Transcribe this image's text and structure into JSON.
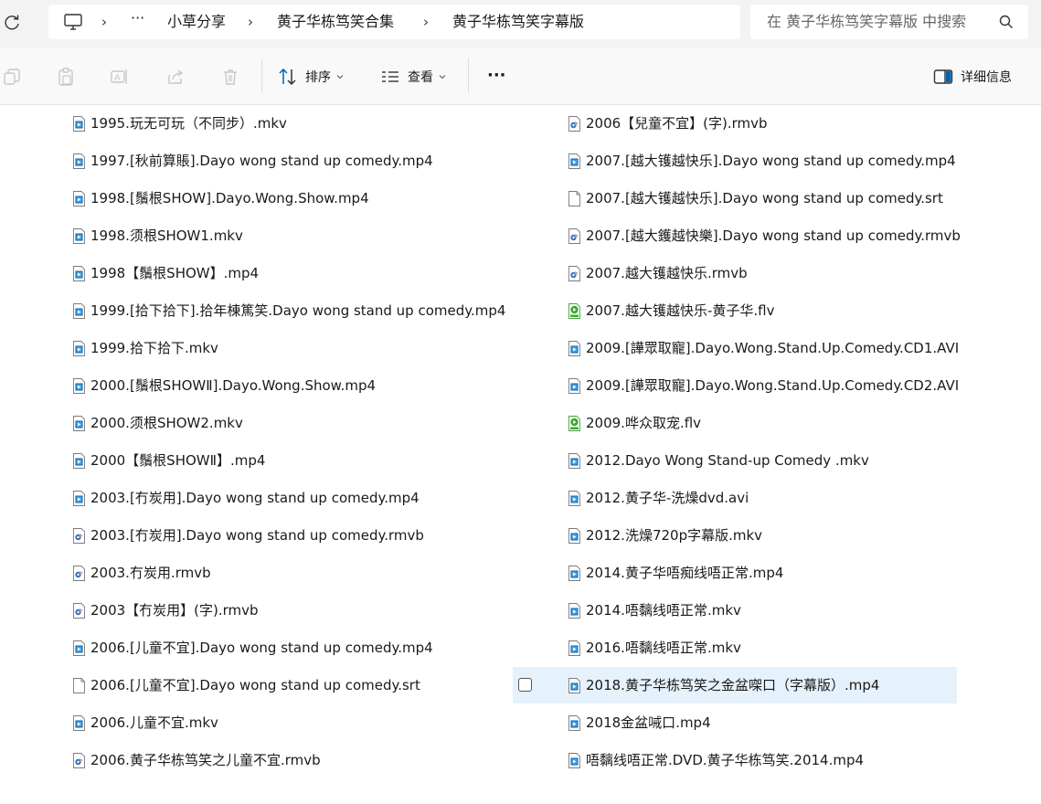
{
  "address": {
    "breadcrumbs": [
      "小草分享",
      "黄子华栋笃笑合集",
      "黄子华栋笃笑字幕版"
    ],
    "more": "···",
    "separator": "›",
    "search_placeholder": "在 黄子华栋笃笑字幕版 中搜索"
  },
  "toolbar": {
    "sort_label": "排序",
    "view_label": "查看",
    "more_label": "···",
    "details_label": "详细信息"
  },
  "colors": {
    "accent": "#0063b1",
    "selected_bg": "#e5f1fb",
    "flv_green": "#3fa535"
  },
  "files_left": [
    {
      "name": "1995.玩无可玩（不同步）.mkv",
      "icon": "video-file-icon"
    },
    {
      "name": "1997.[秋前算賬].Dayo wong stand up comedy.mp4",
      "icon": "video-file-icon"
    },
    {
      "name": "1998.[鬚根SHOW].Dayo.Wong.Show.mp4",
      "icon": "video-file-icon"
    },
    {
      "name": "1998.须根SHOW1.mkv",
      "icon": "video-file-icon"
    },
    {
      "name": "1998【鬚根SHOW】.mp4",
      "icon": "video-file-icon"
    },
    {
      "name": "1999.[拾下拾下].拾年棟篤笑.Dayo wong stand up comedy.mp4",
      "icon": "video-file-icon"
    },
    {
      "name": "1999.拾下拾下.mkv",
      "icon": "video-file-icon"
    },
    {
      "name": "2000.[鬚根SHOWⅡ].Dayo.Wong.Show.mp4",
      "icon": "video-file-icon"
    },
    {
      "name": "2000.须根SHOW2.mkv",
      "icon": "video-file-icon"
    },
    {
      "name": "2000【鬚根SHOWⅡ】.mp4",
      "icon": "video-file-icon"
    },
    {
      "name": "2003.[冇炭用].Dayo wong stand up comedy.mp4",
      "icon": "video-file-icon"
    },
    {
      "name": "2003.[冇炭用].Dayo wong stand up comedy.rmvb",
      "icon": "rmvb-file-icon"
    },
    {
      "name": "2003.冇炭用.rmvb",
      "icon": "rmvb-file-icon"
    },
    {
      "name": "2003【冇炭用】(字).rmvb",
      "icon": "rmvb-file-icon"
    },
    {
      "name": "2006.[儿童不宜].Dayo wong stand up comedy.mp4",
      "icon": "video-file-icon"
    },
    {
      "name": "2006.[儿童不宜].Dayo wong stand up comedy.srt",
      "icon": "blank-file-icon"
    },
    {
      "name": "2006.儿童不宜.mkv",
      "icon": "video-file-icon"
    },
    {
      "name": "2006.黄子华栋笃笑之儿童不宜.rmvb",
      "icon": "rmvb-file-icon"
    }
  ],
  "files_right": [
    {
      "name": "2006【兒童不宜】(字).rmvb",
      "icon": "rmvb-file-icon"
    },
    {
      "name": "2007.[越大镬越快乐].Dayo wong stand up comedy.mp4",
      "icon": "video-file-icon"
    },
    {
      "name": "2007.[越大镬越快乐].Dayo wong stand up comedy.srt",
      "icon": "blank-file-icon"
    },
    {
      "name": "2007.[越大鑊越快樂].Dayo wong stand up comedy.rmvb",
      "icon": "rmvb-file-icon"
    },
    {
      "name": "2007.越大镬越快乐.rmvb",
      "icon": "rmvb-file-icon"
    },
    {
      "name": "2007.越大镬越快乐-黄子华.flv",
      "icon": "flv-file-icon"
    },
    {
      "name": "2009.[譁眾取寵].Dayo.Wong.Stand.Up.Comedy.CD1.AVI",
      "icon": "video-file-icon"
    },
    {
      "name": "2009.[譁眾取寵].Dayo.Wong.Stand.Up.Comedy.CD2.AVI",
      "icon": "video-file-icon"
    },
    {
      "name": "2009.哗众取宠.flv",
      "icon": "flv-file-icon"
    },
    {
      "name": "2012.Dayo Wong Stand-up Comedy .mkv",
      "icon": "video-file-icon"
    },
    {
      "name": "2012.黄子华-洗燥dvd.avi",
      "icon": "video-file-icon"
    },
    {
      "name": "2012.洗燥720p字幕版.mkv",
      "icon": "video-file-icon"
    },
    {
      "name": "2014.黄子华唔痴线唔正常.mp4",
      "icon": "video-file-icon"
    },
    {
      "name": "2014.唔黐线唔正常.mkv",
      "icon": "video-file-icon"
    },
    {
      "name": "2016.唔黐线唔正常.mkv",
      "icon": "video-file-icon"
    },
    {
      "name": "2018.黄子华栋笃笑之金盆㗎口（字幕版）.mp4",
      "icon": "video-file-icon",
      "selected": true
    },
    {
      "name": "2018金盆㖑口.mp4",
      "icon": "video-file-icon"
    },
    {
      "name": "唔黐线唔正常.DVD.黄子华栋笃笑.2014.mp4",
      "icon": "video-file-icon"
    }
  ]
}
